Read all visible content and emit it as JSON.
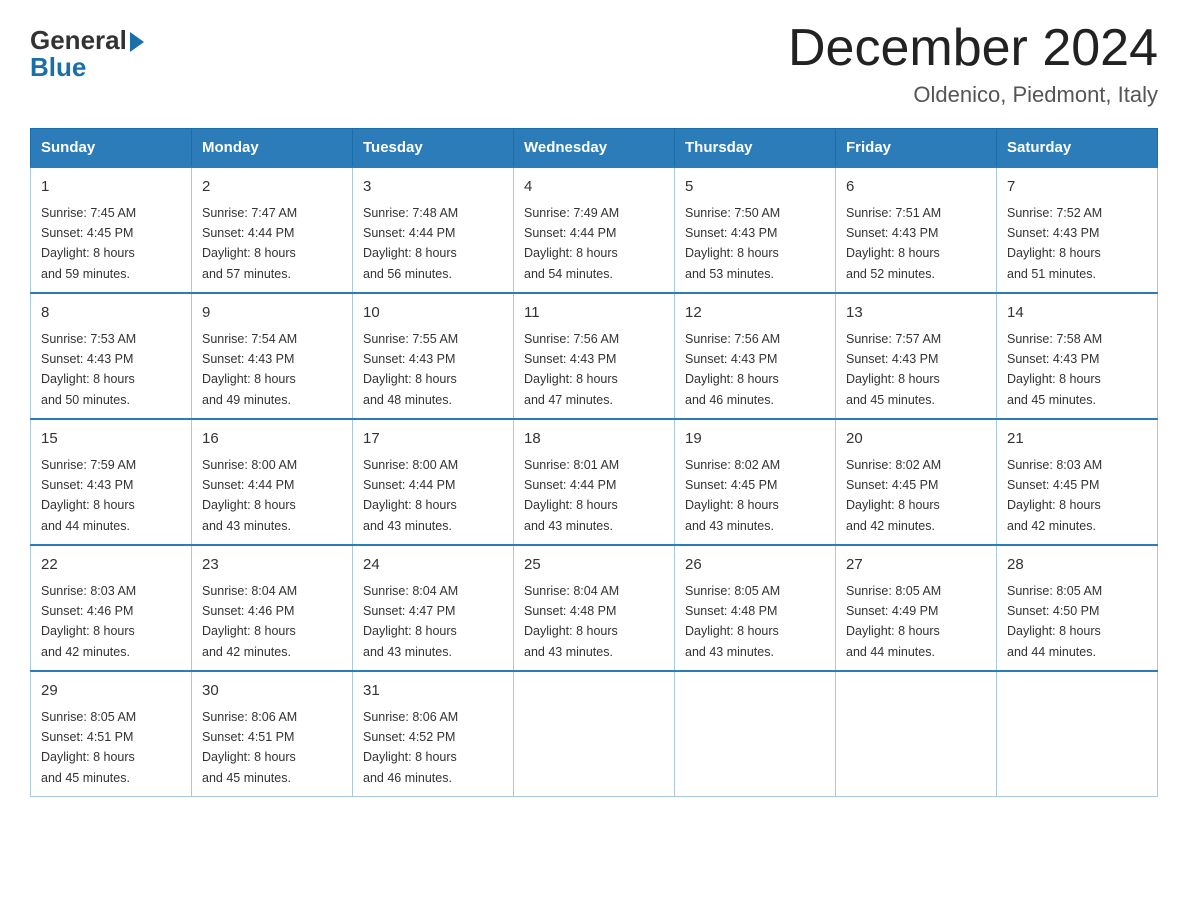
{
  "logo": {
    "general": "General",
    "blue": "Blue"
  },
  "header": {
    "month_year": "December 2024",
    "location": "Oldenico, Piedmont, Italy"
  },
  "days_of_week": [
    "Sunday",
    "Monday",
    "Tuesday",
    "Wednesday",
    "Thursday",
    "Friday",
    "Saturday"
  ],
  "weeks": [
    [
      {
        "day": "1",
        "sunrise": "7:45 AM",
        "sunset": "4:45 PM",
        "daylight": "8 hours and 59 minutes."
      },
      {
        "day": "2",
        "sunrise": "7:47 AM",
        "sunset": "4:44 PM",
        "daylight": "8 hours and 57 minutes."
      },
      {
        "day": "3",
        "sunrise": "7:48 AM",
        "sunset": "4:44 PM",
        "daylight": "8 hours and 56 minutes."
      },
      {
        "day": "4",
        "sunrise": "7:49 AM",
        "sunset": "4:44 PM",
        "daylight": "8 hours and 54 minutes."
      },
      {
        "day": "5",
        "sunrise": "7:50 AM",
        "sunset": "4:43 PM",
        "daylight": "8 hours and 53 minutes."
      },
      {
        "day": "6",
        "sunrise": "7:51 AM",
        "sunset": "4:43 PM",
        "daylight": "8 hours and 52 minutes."
      },
      {
        "day": "7",
        "sunrise": "7:52 AM",
        "sunset": "4:43 PM",
        "daylight": "8 hours and 51 minutes."
      }
    ],
    [
      {
        "day": "8",
        "sunrise": "7:53 AM",
        "sunset": "4:43 PM",
        "daylight": "8 hours and 50 minutes."
      },
      {
        "day": "9",
        "sunrise": "7:54 AM",
        "sunset": "4:43 PM",
        "daylight": "8 hours and 49 minutes."
      },
      {
        "day": "10",
        "sunrise": "7:55 AM",
        "sunset": "4:43 PM",
        "daylight": "8 hours and 48 minutes."
      },
      {
        "day": "11",
        "sunrise": "7:56 AM",
        "sunset": "4:43 PM",
        "daylight": "8 hours and 47 minutes."
      },
      {
        "day": "12",
        "sunrise": "7:56 AM",
        "sunset": "4:43 PM",
        "daylight": "8 hours and 46 minutes."
      },
      {
        "day": "13",
        "sunrise": "7:57 AM",
        "sunset": "4:43 PM",
        "daylight": "8 hours and 45 minutes."
      },
      {
        "day": "14",
        "sunrise": "7:58 AM",
        "sunset": "4:43 PM",
        "daylight": "8 hours and 45 minutes."
      }
    ],
    [
      {
        "day": "15",
        "sunrise": "7:59 AM",
        "sunset": "4:43 PM",
        "daylight": "8 hours and 44 minutes."
      },
      {
        "day": "16",
        "sunrise": "8:00 AM",
        "sunset": "4:44 PM",
        "daylight": "8 hours and 43 minutes."
      },
      {
        "day": "17",
        "sunrise": "8:00 AM",
        "sunset": "4:44 PM",
        "daylight": "8 hours and 43 minutes."
      },
      {
        "day": "18",
        "sunrise": "8:01 AM",
        "sunset": "4:44 PM",
        "daylight": "8 hours and 43 minutes."
      },
      {
        "day": "19",
        "sunrise": "8:02 AM",
        "sunset": "4:45 PM",
        "daylight": "8 hours and 43 minutes."
      },
      {
        "day": "20",
        "sunrise": "8:02 AM",
        "sunset": "4:45 PM",
        "daylight": "8 hours and 42 minutes."
      },
      {
        "day": "21",
        "sunrise": "8:03 AM",
        "sunset": "4:45 PM",
        "daylight": "8 hours and 42 minutes."
      }
    ],
    [
      {
        "day": "22",
        "sunrise": "8:03 AM",
        "sunset": "4:46 PM",
        "daylight": "8 hours and 42 minutes."
      },
      {
        "day": "23",
        "sunrise": "8:04 AM",
        "sunset": "4:46 PM",
        "daylight": "8 hours and 42 minutes."
      },
      {
        "day": "24",
        "sunrise": "8:04 AM",
        "sunset": "4:47 PM",
        "daylight": "8 hours and 43 minutes."
      },
      {
        "day": "25",
        "sunrise": "8:04 AM",
        "sunset": "4:48 PM",
        "daylight": "8 hours and 43 minutes."
      },
      {
        "day": "26",
        "sunrise": "8:05 AM",
        "sunset": "4:48 PM",
        "daylight": "8 hours and 43 minutes."
      },
      {
        "day": "27",
        "sunrise": "8:05 AM",
        "sunset": "4:49 PM",
        "daylight": "8 hours and 44 minutes."
      },
      {
        "day": "28",
        "sunrise": "8:05 AM",
        "sunset": "4:50 PM",
        "daylight": "8 hours and 44 minutes."
      }
    ],
    [
      {
        "day": "29",
        "sunrise": "8:05 AM",
        "sunset": "4:51 PM",
        "daylight": "8 hours and 45 minutes."
      },
      {
        "day": "30",
        "sunrise": "8:06 AM",
        "sunset": "4:51 PM",
        "daylight": "8 hours and 45 minutes."
      },
      {
        "day": "31",
        "sunrise": "8:06 AM",
        "sunset": "4:52 PM",
        "daylight": "8 hours and 46 minutes."
      },
      null,
      null,
      null,
      null
    ]
  ],
  "labels": {
    "sunrise": "Sunrise:",
    "sunset": "Sunset:",
    "daylight": "Daylight:"
  }
}
